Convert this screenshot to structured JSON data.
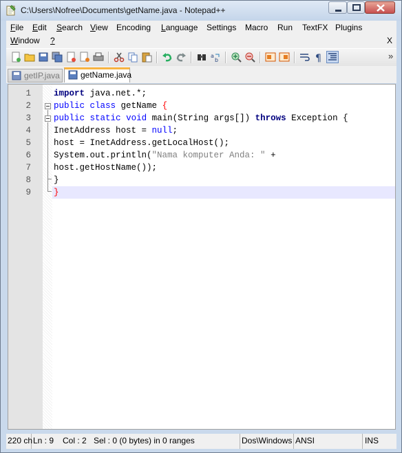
{
  "window": {
    "title": "C:\\Users\\Nofree\\Documents\\getName.java - Notepad++"
  },
  "menu": {
    "row1": [
      {
        "underline": "F",
        "rest": "ile"
      },
      {
        "underline": "E",
        "rest": "dit"
      },
      {
        "underline": "S",
        "rest": "earch"
      },
      {
        "underline": "V",
        "rest": "iew"
      },
      {
        "underline": "",
        "rest": "Encoding"
      },
      {
        "underline": "L",
        "rest": "anguage"
      },
      {
        "underline": "",
        "rest": "Settings"
      },
      {
        "underline": "",
        "rest": "Macro"
      },
      {
        "underline": "",
        "rest": "Run"
      },
      {
        "underline": "",
        "rest": "TextFX"
      },
      {
        "underline": "",
        "rest": "Plugins"
      }
    ],
    "row2": [
      {
        "underline": "W",
        "rest": "indow"
      },
      {
        "underline": "?",
        "rest": ""
      }
    ],
    "close_doc": "X"
  },
  "toolbar": {
    "overflow": "»"
  },
  "tabs": [
    {
      "label": "getIP.java",
      "active": false
    },
    {
      "label": "getName.java",
      "active": true
    }
  ],
  "editor": {
    "line_numbers": [
      "1",
      "2",
      "3",
      "4",
      "5",
      "6",
      "7",
      "8",
      "9"
    ],
    "lines": [
      [
        {
          "t": "import",
          "c": "kw2"
        },
        {
          "t": " java.net.*;",
          "c": "plain"
        }
      ],
      [
        {
          "t": "public",
          "c": "kw"
        },
        {
          "t": " ",
          "c": "plain"
        },
        {
          "t": "class",
          "c": "kw"
        },
        {
          "t": " getName ",
          "c": "plain"
        },
        {
          "t": "{",
          "c": "red"
        }
      ],
      [
        {
          "t": "public",
          "c": "kw"
        },
        {
          "t": " ",
          "c": "plain"
        },
        {
          "t": "static",
          "c": "kw"
        },
        {
          "t": " ",
          "c": "plain"
        },
        {
          "t": "void",
          "c": "kw"
        },
        {
          "t": " main(String args[]) ",
          "c": "plain"
        },
        {
          "t": "throws",
          "c": "kw2"
        },
        {
          "t": " Exception {",
          "c": "plain"
        }
      ],
      [
        {
          "t": "InetAddress host = ",
          "c": "plain"
        },
        {
          "t": "null",
          "c": "kw"
        },
        {
          "t": ";",
          "c": "plain"
        }
      ],
      [
        {
          "t": "host = InetAddress.getLocalHost();",
          "c": "plain"
        }
      ],
      [
        {
          "t": "System.out.println(",
          "c": "plain"
        },
        {
          "t": "\"Nama komputer Anda: \"",
          "c": "str"
        },
        {
          "t": " +",
          "c": "plain"
        }
      ],
      [
        {
          "t": "host.getHostName());",
          "c": "plain"
        }
      ],
      [
        {
          "t": "}",
          "c": "plain"
        }
      ],
      [
        {
          "t": "}",
          "c": "red"
        }
      ]
    ]
  },
  "status": {
    "chars": "220 ch",
    "line": "Ln : 9",
    "col": "Col : 2",
    "sel": "Sel : 0 (0 bytes) in 0 ranges",
    "eol": "Dos\\Windows",
    "encoding": "ANSI",
    "mode": "INS"
  }
}
